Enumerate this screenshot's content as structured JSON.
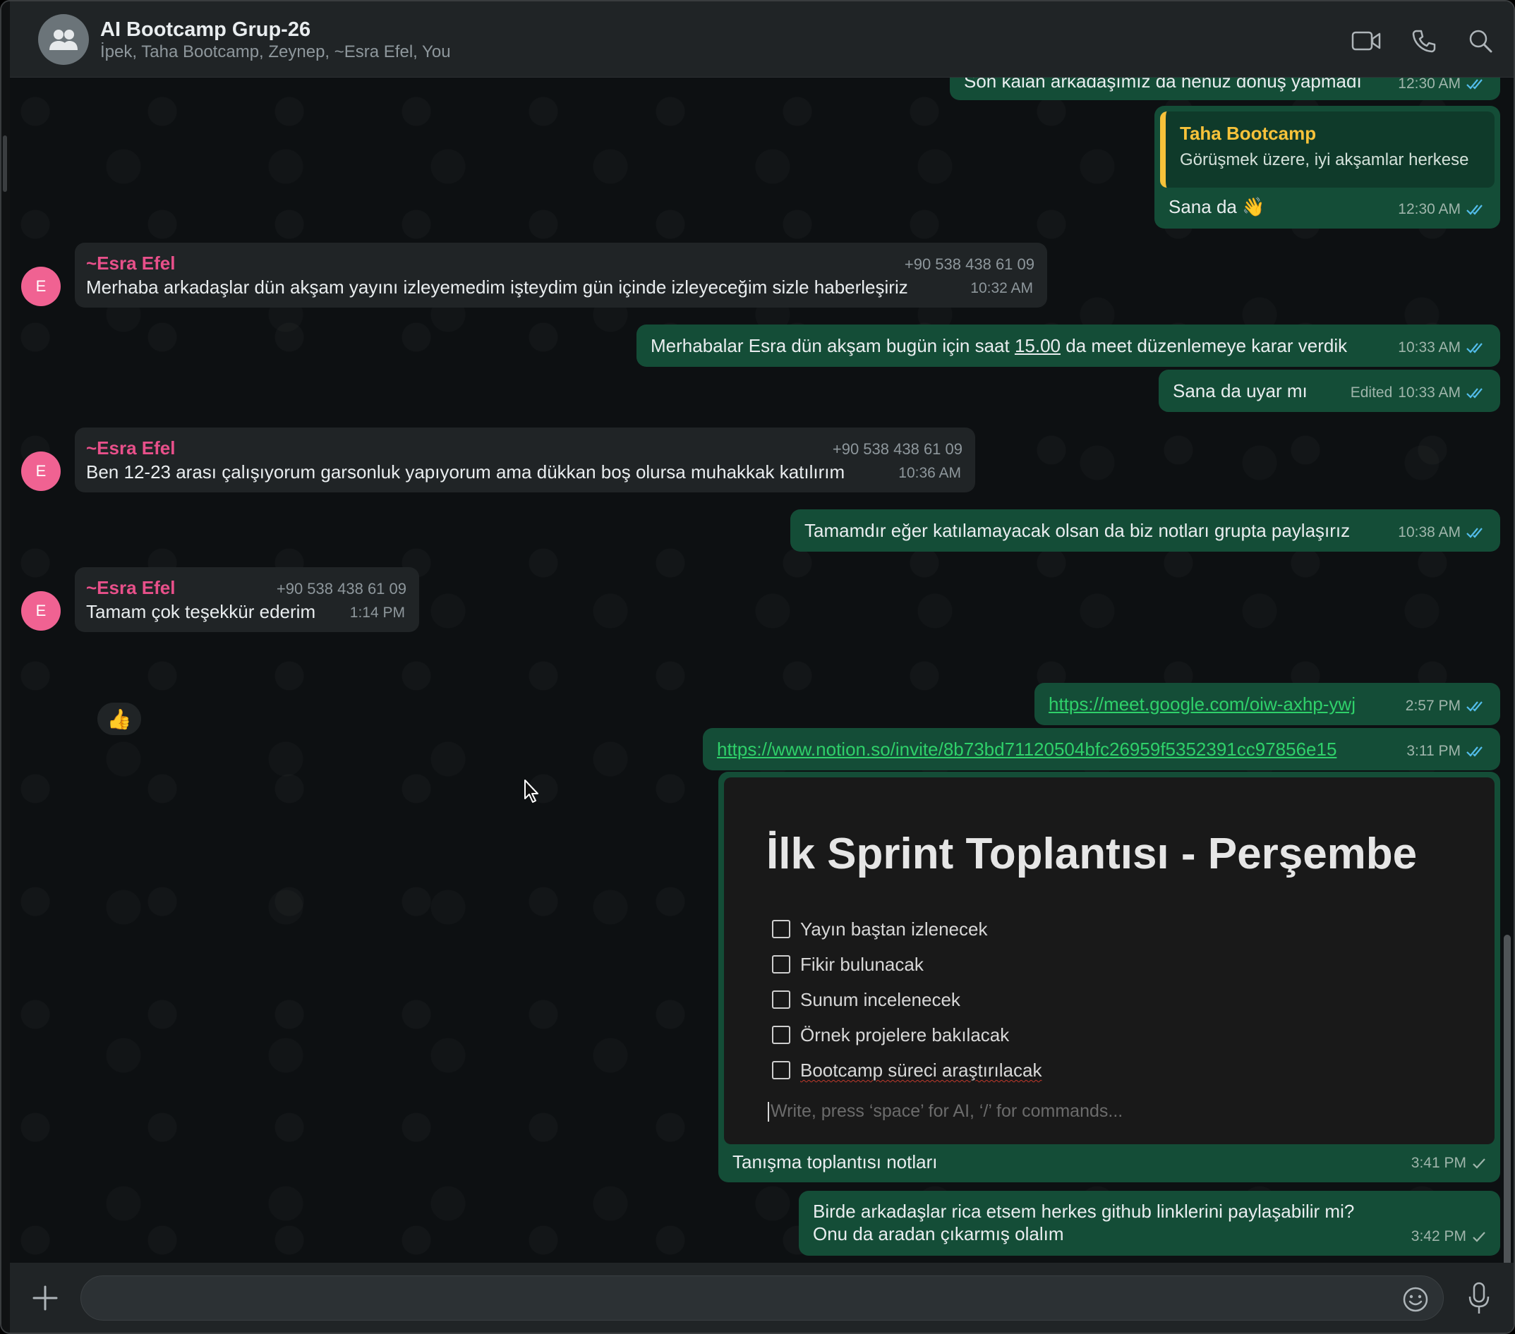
{
  "header": {
    "title": "AI Bootcamp Grup-26",
    "members": "İpek, Taha Bootcamp, Zeynep, ~Esra Efel, You",
    "icons": [
      "video-call-icon",
      "voice-call-icon",
      "search-icon"
    ]
  },
  "messages": {
    "m0": {
      "text": "Son kalan arkadaşımız da henüz dönüş yapmadı",
      "time": "12:30 AM"
    },
    "m1": {
      "quote_sender": "Taha Bootcamp",
      "quote_text": "Görüşmek üzere, iyi akşamlar herkese",
      "text": "Sana da 👋",
      "time": "12:30 AM"
    },
    "m2": {
      "avatar": "E",
      "sender": "~Esra Efel",
      "phone": "+90 538 438 61 09",
      "text": "Merhaba arkadaşlar dün akşam yayını izleyemedim işteydim gün içinde izleyeceğim sizle haberleşiriz",
      "time": "10:32 AM"
    },
    "m3": {
      "text_before": "Merhabalar Esra dün akşam bugün için saat ",
      "text_link": "15.00",
      "text_after": " da meet düzenlemeye karar verdik",
      "time": "10:33 AM"
    },
    "m4": {
      "text": "Sana da uyar mı",
      "edited": "Edited",
      "time": "10:33 AM"
    },
    "m5": {
      "avatar": "E",
      "sender": "~Esra Efel",
      "phone": "+90 538 438 61 09",
      "text": "Ben 12-23 arası çalışıyorum garsonluk yapıyorum ama dükkan boş olursa muhakkak katılırım",
      "time": "10:36 AM"
    },
    "m6": {
      "text": "Tamamdır eğer katılamayacak olsan da biz notları grupta paylaşırız",
      "time": "10:38 AM"
    },
    "m7": {
      "avatar": "E",
      "sender": "~Esra Efel",
      "phone": "+90 538 438 61 09",
      "text": "Tamam çok teşekkür ederim",
      "time": "1:14 PM",
      "reaction": "👍"
    },
    "m8": {
      "link": "https://meet.google.com/oiw-axhp-ywj",
      "time": "2:57 PM"
    },
    "m9": {
      "link": "https://www.notion.so/invite/8b73bd71120504bfc26959f5352391cc97856e15",
      "time": "3:11 PM"
    },
    "m10": {
      "notion_title": "İlk Sprint Toplantısı - Perşembe",
      "todos": [
        "Yayın baştan izlenecek",
        "Fikir bulunacak",
        "Sunum incelenecek",
        "Örnek projelere bakılacak",
        "Bootcamp süreci araştırılacak"
      ],
      "placeholder": "Write, press ‘space’ for AI, ‘/’ for commands...",
      "caption": "Tanışma toplantısı notları",
      "time": "3:41 PM"
    },
    "m11": {
      "line1": "Birde arkadaşlar rica etsem herkes github linklerini paylaşabilir mi?",
      "line2": "Onu da aradan çıkarmış olalım",
      "time": "3:42 PM"
    }
  },
  "composer": {
    "input_value": "",
    "icons": [
      "plus-icon",
      "emoji-icon",
      "microphone-icon"
    ]
  },
  "colors": {
    "outgoing_bubble": "#144d37",
    "incoming_bubble": "#202426",
    "sender_name": "#e8508a",
    "quote_accent": "#f7c23a",
    "link": "#2fd06a",
    "read_ticks": "#53bdeb"
  }
}
